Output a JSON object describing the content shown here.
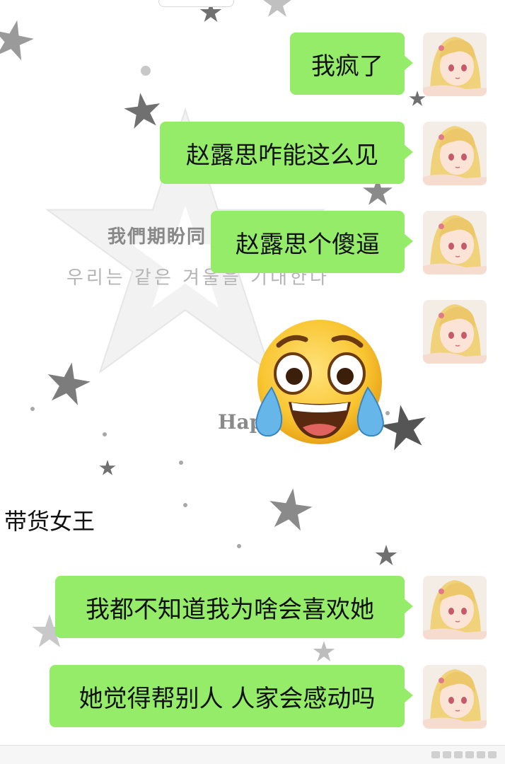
{
  "chat": {
    "messages_top": [
      {
        "text": "我疯了"
      },
      {
        "text": "赵露思咋能这么见"
      },
      {
        "text": "赵露思个傻逼"
      }
    ],
    "emoji_message": {
      "emoji": "loudly-laughing-crying-emoji"
    },
    "sender_name": "带货女王",
    "messages_bottom": [
      {
        "text": "我都不知道我为啥会喜欢她"
      },
      {
        "text": "她觉得帮别人 人家会感动吗"
      }
    ]
  },
  "background": {
    "watermark_cn": "我們期盼同",
    "watermark_kr": "우리는 같은 겨울을 기대한다",
    "watermark_happy": "Happ"
  },
  "colors": {
    "bubble": "#95ec69",
    "star": "#6f6f6f",
    "background": "#ffffff"
  }
}
